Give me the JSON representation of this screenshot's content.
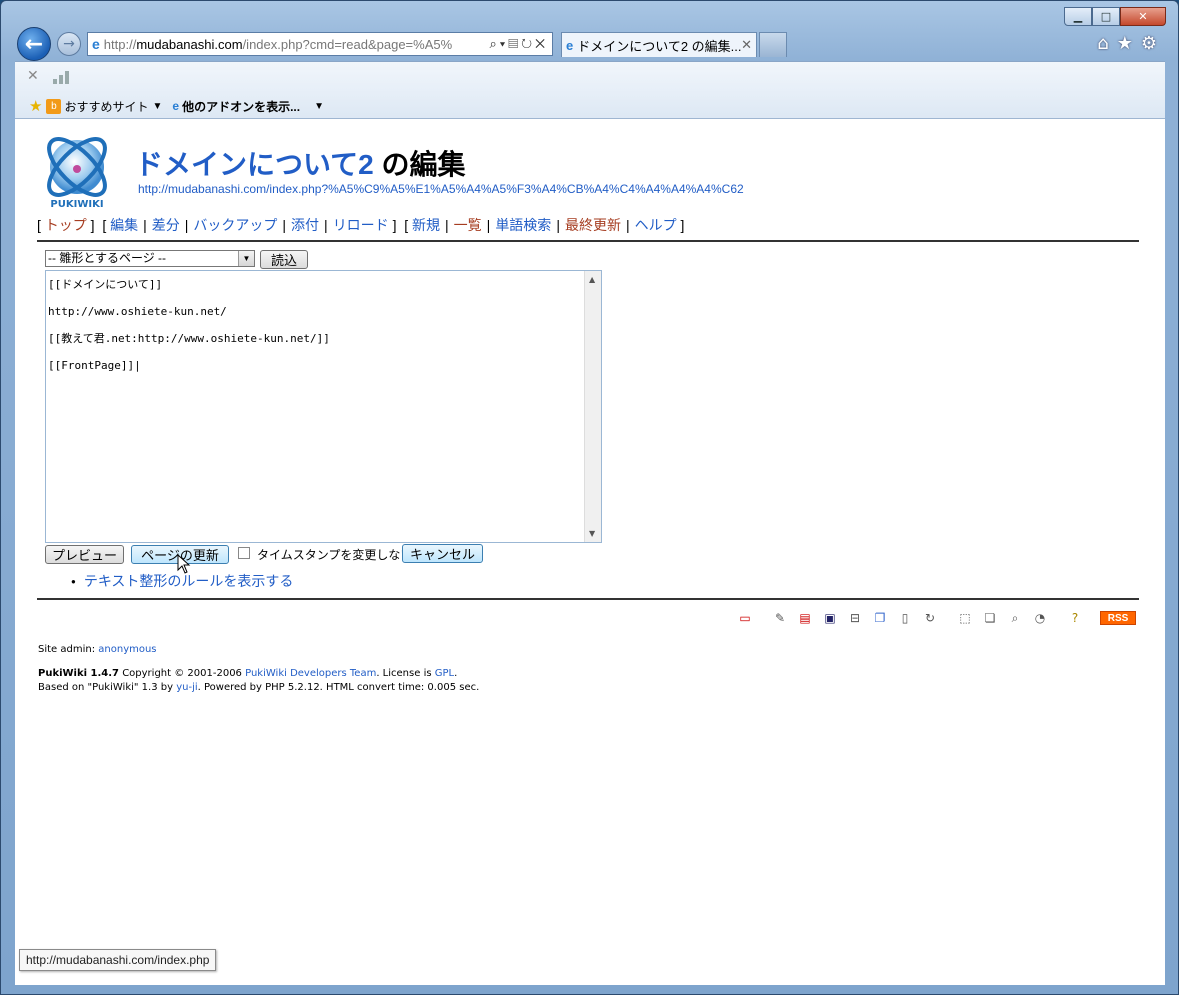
{
  "browser": {
    "address": {
      "prefix": "http://",
      "domain": "mudabanashi.com",
      "rest": "/index.php?cmd=read&page=%A5%"
    },
    "tab_title": "ドメインについて2 の編集...",
    "favorites": {
      "recommended": "おすすめサイト",
      "addons": "他のアドオンを表示..."
    },
    "status_url": "http://mudabanashi.com/index.php"
  },
  "page": {
    "title_link": "ドメインについて2",
    "title_suffix": " の編集",
    "url": "http://mudabanashi.com/index.php?%A5%C9%A5%E1%A5%A4%A5%F3%A4%CB%A4%C4%A4%A4%A4%C62",
    "menu": {
      "top": "トップ",
      "edit": "編集",
      "diff": "差分",
      "backup": "バックアップ",
      "attach": "添付",
      "reload": "リロード",
      "new": "新規",
      "list": "一覧",
      "search": "単語検索",
      "recent": "最終更新",
      "help": "ヘルプ"
    },
    "template_select": "-- 雛形とするページ --",
    "read_button": "読込",
    "editor_text": "[[ドメインについて]]\nhttp://www.oshiete-kun.net/\n[[教えて君.net:http://www.oshiete-kun.net/]]\n[[FrontPage]]|",
    "preview_button": "プレビュー",
    "update_button": "ページの更新",
    "timestamp_label": "タイムスタンプを変更しない",
    "cancel_button": "キャンセル",
    "rules_link": "テキスト整形のルールを表示する",
    "rss": "RSS",
    "site_admin_label": "Site admin: ",
    "site_admin_name": "anonymous",
    "footer": {
      "version": "PukiWiki 1.4.7",
      "copyright": " Copyright © 2001-2006 ",
      "team": "PukiWiki Developers Team",
      "license": ". License is ",
      "gpl": "GPL",
      "dot": ".",
      "based": "Based on \"PukiWiki\" 1.3 by ",
      "yuji": "yu-ji",
      "powered": ". Powered by PHP 5.2.12. HTML convert time: 0.005 sec."
    }
  },
  "colors": {
    "link": "#215dc6",
    "visited": "#a63d21"
  }
}
